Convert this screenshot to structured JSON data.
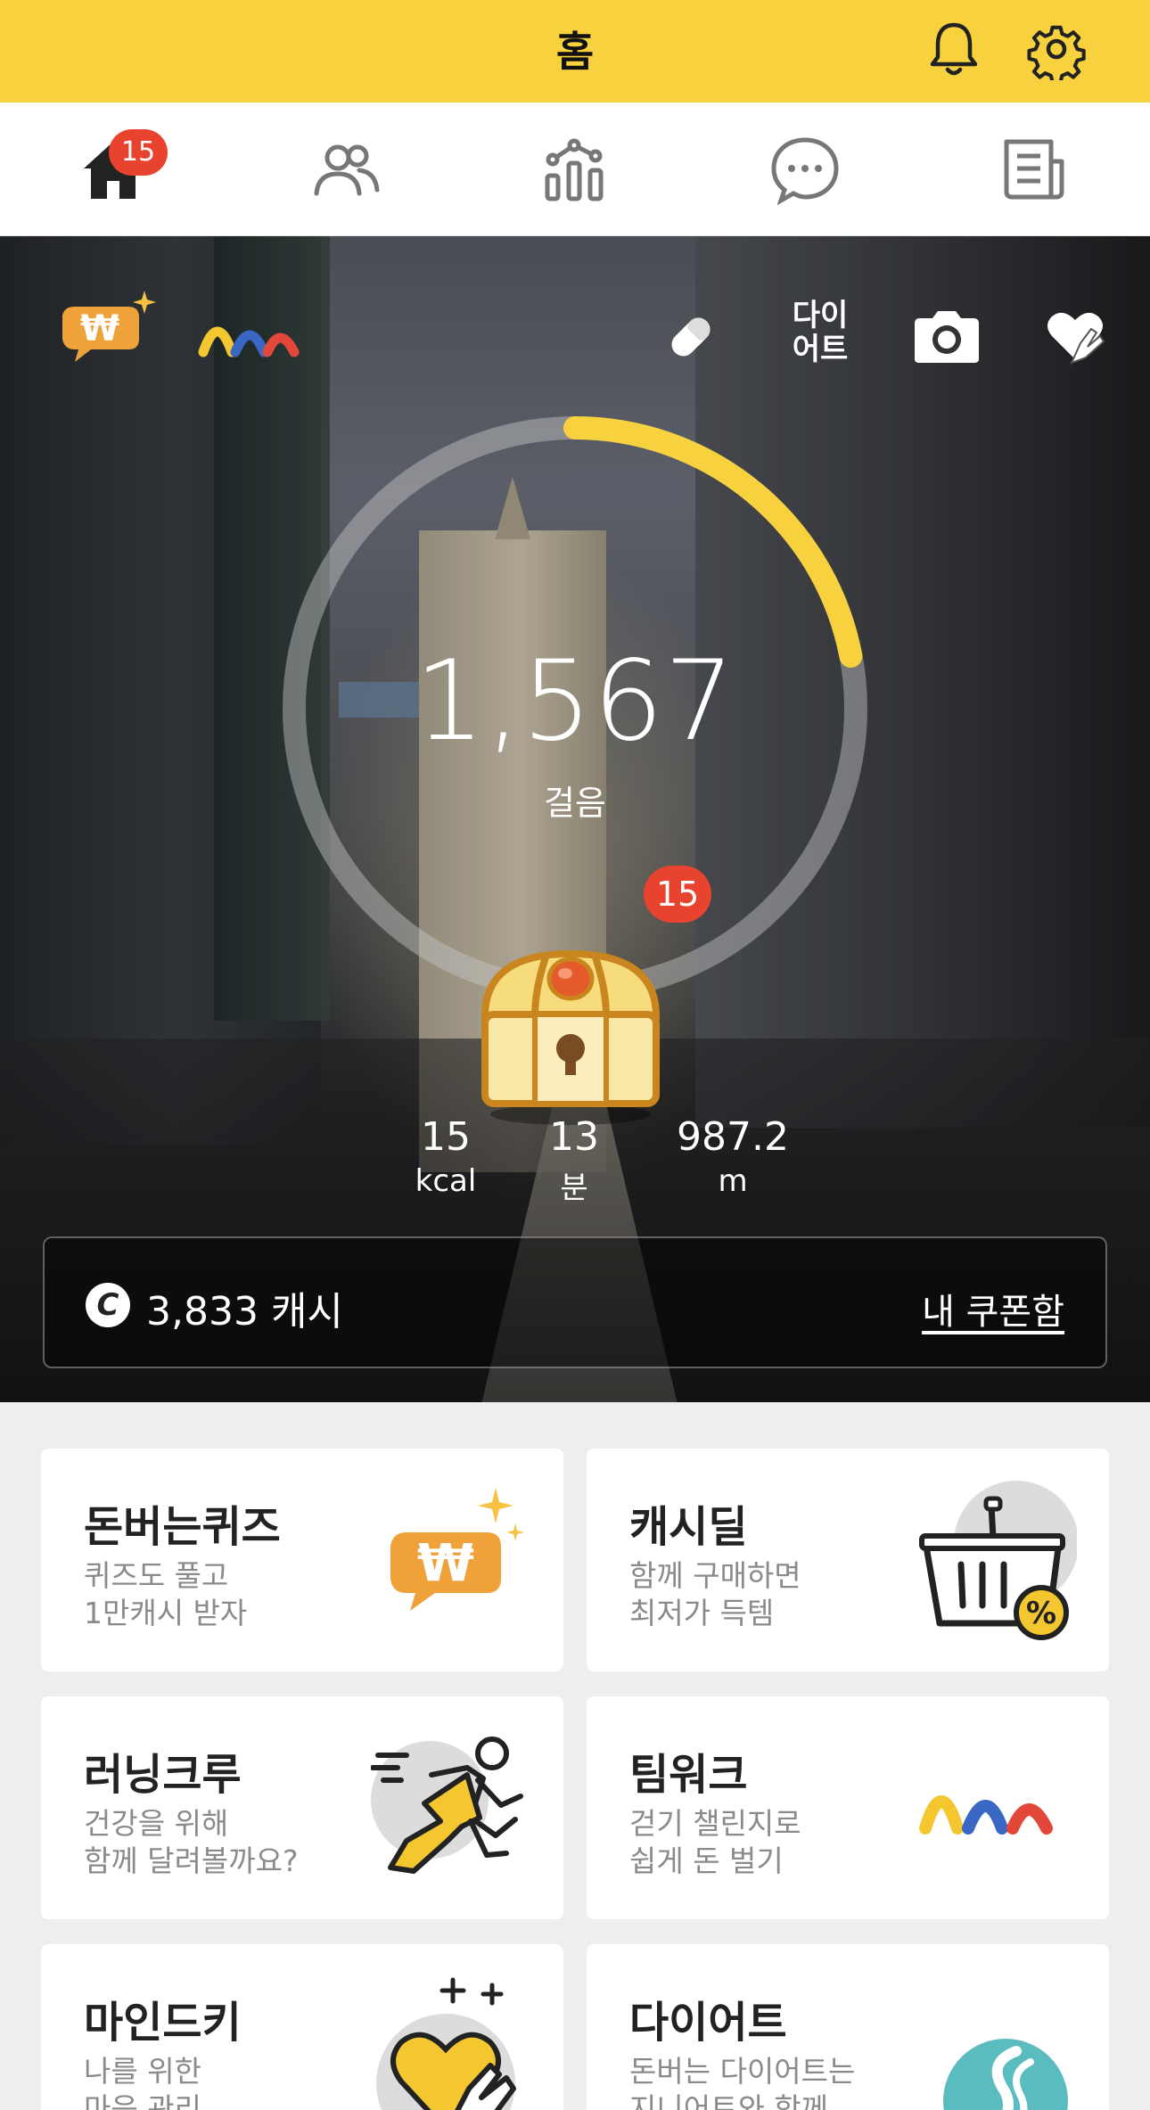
{
  "header": {
    "title": "홈",
    "icons": [
      "bell-icon",
      "gear-icon"
    ]
  },
  "tabs": [
    {
      "name": "home",
      "icon": "home-icon",
      "badge": "15",
      "active": true
    },
    {
      "name": "friends",
      "icon": "people-icon"
    },
    {
      "name": "stats",
      "icon": "chart-icon"
    },
    {
      "name": "chat",
      "icon": "chat-icon"
    },
    {
      "name": "news",
      "icon": "news-icon"
    }
  ],
  "hero": {
    "diet_label_line1": "다이",
    "diet_label_line2": "어트",
    "steps": "1,567",
    "steps_unit": "걸음",
    "progress_fraction": 0.22,
    "chest_badge": "15",
    "stats": [
      {
        "value": "15",
        "unit": "kcal"
      },
      {
        "value": "13",
        "unit": "분"
      },
      {
        "value": "987.2",
        "unit": "m"
      }
    ],
    "cash_icon": "C",
    "cash": "3,833 캐시",
    "coupon_link": "내 쿠폰함"
  },
  "cards": [
    {
      "title": "돈버는퀴즈",
      "sub1": "퀴즈도 풀고",
      "sub2": "1만캐시 받자",
      "icon": "won-quiz-icon"
    },
    {
      "title": "캐시딜",
      "sub1": "함께 구매하면",
      "sub2": "최저가 득템",
      "icon": "basket-icon"
    },
    {
      "title": "러닝크루",
      "sub1": "건강을 위해",
      "sub2": "함께 달려볼까요?",
      "icon": "runner-icon"
    },
    {
      "title": "팀워크",
      "sub1": "걷기 챌린지로",
      "sub2": "쉽게 돈 벌기",
      "icon": "teamwork-icon"
    },
    {
      "title": "마인드키",
      "sub1": "나를 위한",
      "sub2": "마음 관리",
      "icon": "heart-hand-icon"
    },
    {
      "title": "다이어트",
      "sub1": "돈버는 다이어트는",
      "sub2": "지니어트와 함께",
      "icon": "dietgenie-icon"
    }
  ],
  "colors": {
    "accent": "#f7d23e",
    "badge": "#e8432e",
    "teamwork_yellow": "#f4c630",
    "teamwork_blue": "#3a66c4",
    "teamwork_red": "#e2473a"
  }
}
